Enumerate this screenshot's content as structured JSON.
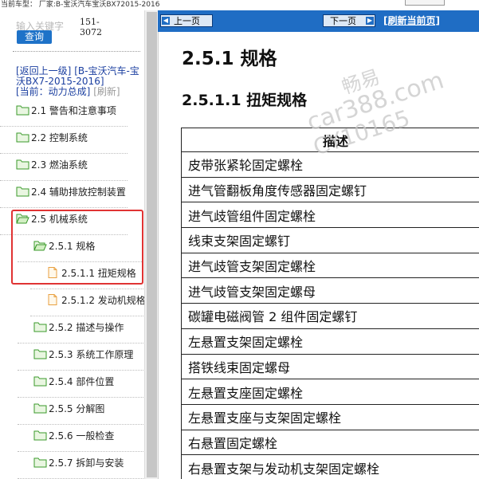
{
  "top": {
    "car_label": "当前车型： 厂家:B-宝沃汽车宝沃BX72015-2016"
  },
  "search": {
    "placeholder": "输入关键",
    "suffix": "字",
    "button": "查询",
    "count": "151-3072"
  },
  "crumbs": {
    "back": "[返回上一级]",
    "model": "[B-宝沃汽车-宝沃BX7-2015-2016]",
    "current": "[当前：动力总成]",
    "refresh": "[刷新]"
  },
  "tree": [
    {
      "label": "2.1 警告和注意事项",
      "icon": "folder"
    },
    {
      "label": "2.2 控制系统",
      "icon": "folder"
    },
    {
      "label": "2.3 燃油系统",
      "icon": "folder"
    },
    {
      "label": "2.4 辅助排放控制装置",
      "icon": "folder"
    },
    {
      "label": "2.5 机械系统",
      "icon": "folder-open"
    },
    {
      "label": "2.5.1 规格",
      "icon": "folder-open"
    },
    {
      "label": "2.5.1.1 扭矩规格",
      "icon": "page"
    },
    {
      "label": "2.5.1.2 发动机规格",
      "icon": "page"
    },
    {
      "label": "2.5.2 描述与操作",
      "icon": "folder"
    },
    {
      "label": "2.5.3 系统工作原理",
      "icon": "folder"
    },
    {
      "label": "2.5.4 部件位置",
      "icon": "folder"
    },
    {
      "label": "2.5.5 分解图",
      "icon": "folder"
    },
    {
      "label": "2.5.6 一般检查",
      "icon": "folder"
    },
    {
      "label": "2.5.7 拆卸与安装",
      "icon": "folder"
    }
  ],
  "nav": {
    "prev": "上一页",
    "next": "下一页",
    "refresh": "[刷新当前页]"
  },
  "content": {
    "title": "2.5.1 规格",
    "subtitle": "2.5.1.1 扭矩规格",
    "watermark": [
      "畅易",
      "car388.com",
      "CY10165"
    ],
    "table_header": "描述",
    "rows": [
      "皮带张紧轮固定螺栓",
      "进气管翻板角度传感器固定螺钉",
      "进气歧管组件固定螺栓",
      "线束支架固定螺钉",
      "进气歧管支架固定螺栓",
      "进气歧管支架固定螺母",
      "碳罐电磁阀管 2 组件固定螺钉",
      "左悬置支架固定螺栓",
      "搭铁线束固定螺母",
      "左悬置支座固定螺栓",
      "左悬置支座与支架固定螺栓",
      "右悬置固定螺栓",
      "右悬置支架与发动机支架固定螺栓"
    ]
  },
  "colors": {
    "nav_blue": "#1f6dc4",
    "link_blue": "#1b3fa0",
    "highlight_red": "#e03333",
    "folder_green": "#3a9a2a",
    "page_orange": "#e8a040"
  }
}
